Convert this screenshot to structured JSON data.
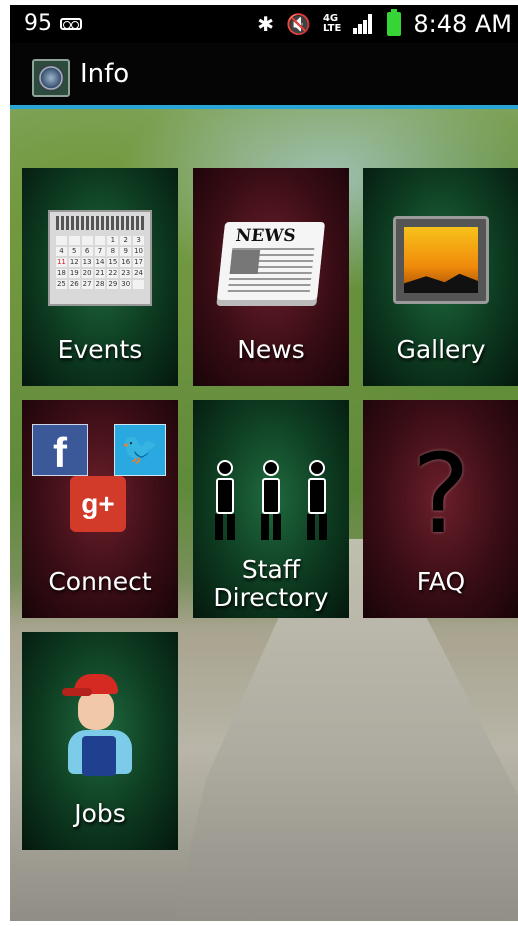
{
  "status_bar": {
    "notification_count": "95",
    "time": "8:48 AM",
    "network": "4G LTE",
    "icons": [
      "voicemail-icon",
      "bluetooth-icon",
      "mute-icon",
      "lte-icon",
      "signal-icon",
      "battery-icon"
    ],
    "battery_color": "#37d436"
  },
  "action_bar": {
    "title": "Info",
    "accent_color": "#2aa6d6"
  },
  "tiles": [
    {
      "label": "Events",
      "icon": "calendar-icon"
    },
    {
      "label": "News",
      "icon": "newspaper-icon"
    },
    {
      "label": "Gallery",
      "icon": "gallery-icon"
    },
    {
      "label": "Connect",
      "icon": "social-icons"
    },
    {
      "label": "Staff Directory",
      "label_line1": "Staff",
      "label_line2": "Directory",
      "icon": "people-icon"
    },
    {
      "label": "FAQ",
      "icon": "question-icon"
    },
    {
      "label": "Jobs",
      "icon": "worker-icon"
    }
  ],
  "icon_text": {
    "news": "NEWS",
    "facebook": "f",
    "google_plus": "g+",
    "faq": "?"
  },
  "calendar_days": [
    "",
    "",
    "",
    "",
    "1",
    "2",
    "3",
    "4",
    "5",
    "6",
    "7",
    "8",
    "9",
    "10",
    "11",
    "12",
    "13",
    "14",
    "15",
    "16",
    "17",
    "18",
    "19",
    "20",
    "21",
    "22",
    "23",
    "24",
    "25",
    "26",
    "27",
    "28",
    "29",
    "30",
    ""
  ]
}
